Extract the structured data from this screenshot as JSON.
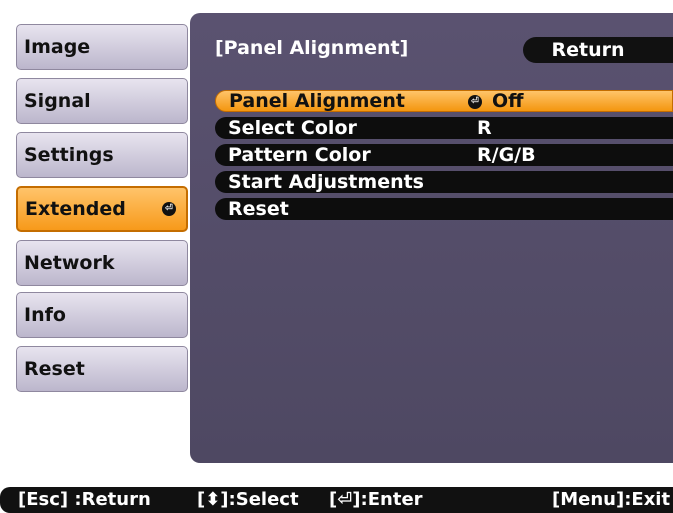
{
  "sidebar": {
    "items": [
      {
        "label": "Image"
      },
      {
        "label": "Signal"
      },
      {
        "label": "Settings"
      },
      {
        "label": "Extended",
        "active": true
      },
      {
        "label": "Network"
      },
      {
        "label": "Info"
      },
      {
        "label": "Reset"
      }
    ]
  },
  "panel": {
    "title": "[Panel Alignment]",
    "return_label": "Return",
    "rows": [
      {
        "label": "Panel Alignment",
        "value": "Off",
        "selected": true
      },
      {
        "label": "Select Color",
        "value": "R"
      },
      {
        "label": "Pattern Color",
        "value": "R/G/B"
      },
      {
        "label": "Start Adjustments",
        "value": ""
      },
      {
        "label": "Reset",
        "value": ""
      }
    ]
  },
  "footer": {
    "return_hint": "[Esc] :Return",
    "select_hint": "[⬍]:Select",
    "enter_hint": "[⏎]:Enter",
    "exit_hint": "[Menu]:Exit"
  },
  "colors": {
    "highlight": "#f79a1a",
    "panel_bg": "#55506b",
    "sidebar_bg": "#d2cde0"
  }
}
